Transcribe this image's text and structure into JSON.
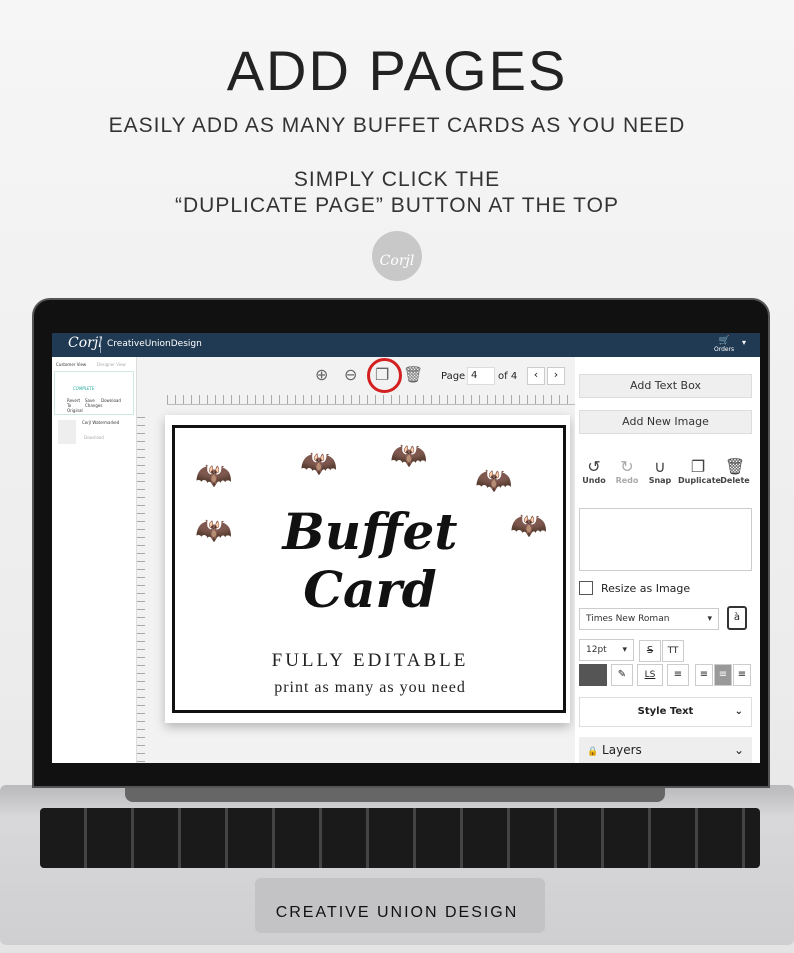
{
  "promo": {
    "title": "ADD PAGES",
    "subtitle": "EASILY ADD AS MANY BUFFET CARDS AS YOU NEED",
    "instruction_line1": "SIMPLY CLICK THE",
    "instruction_line2": "“DUPLICATE PAGE” BUTTON AT THE TOP",
    "badge": "Corjl",
    "footer": "CREATIVE UNION DESIGN"
  },
  "header": {
    "brand": "Corjl",
    "site": "CreativeUnionDesign",
    "orders": "Orders",
    "cart_icon": "cart-icon"
  },
  "left_panel": {
    "tabs": [
      "Customer View",
      "Designer View"
    ],
    "status": "COMPLETE",
    "actions": [
      "Revert To Original",
      "Save Changes",
      "Download"
    ],
    "file_name": "Corjl Watermarked",
    "file_action": "Download"
  },
  "toolbar": {
    "page_label": "Page",
    "page_value": "4",
    "page_total": "of 4",
    "highlight_color": "#d42020"
  },
  "card": {
    "title_line1": "Buffet",
    "title_line2": "Card",
    "line1": "FULLY EDITABLE",
    "line2": "print as many as you need"
  },
  "right_panel": {
    "add_text": "Add Text Box",
    "add_image": "Add New Image",
    "tools": [
      "Undo",
      "Redo",
      "Snap",
      "Duplicate",
      "Delete"
    ],
    "resize": "Resize as Image",
    "font": "Times New Roman",
    "size": "12pt",
    "spacing": "LS",
    "style_text": "Style Text",
    "layers": "Layers"
  }
}
